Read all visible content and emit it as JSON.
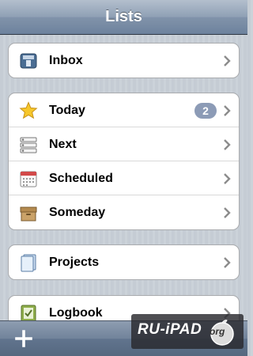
{
  "navbar": {
    "title": "Lists"
  },
  "groups": [
    {
      "rows": [
        {
          "label": "Inbox",
          "icon": "inbox-icon"
        }
      ]
    },
    {
      "rows": [
        {
          "label": "Today",
          "icon": "star-icon",
          "badge": "2"
        },
        {
          "label": "Next",
          "icon": "list-icon"
        },
        {
          "label": "Scheduled",
          "icon": "calendar-icon"
        },
        {
          "label": "Someday",
          "icon": "box-icon"
        }
      ]
    },
    {
      "rows": [
        {
          "label": "Projects",
          "icon": "projects-icon"
        }
      ]
    },
    {
      "rows": [
        {
          "label": "Logbook",
          "icon": "logbook-icon"
        }
      ]
    }
  ],
  "toolbar": {
    "add_label": "+"
  },
  "watermark": {
    "text": "RU-iPAD",
    "suffix": "org"
  },
  "colors": {
    "navbar": "#7f92aa",
    "badge": "#8c9bb6",
    "background": "#c5ccd4"
  }
}
